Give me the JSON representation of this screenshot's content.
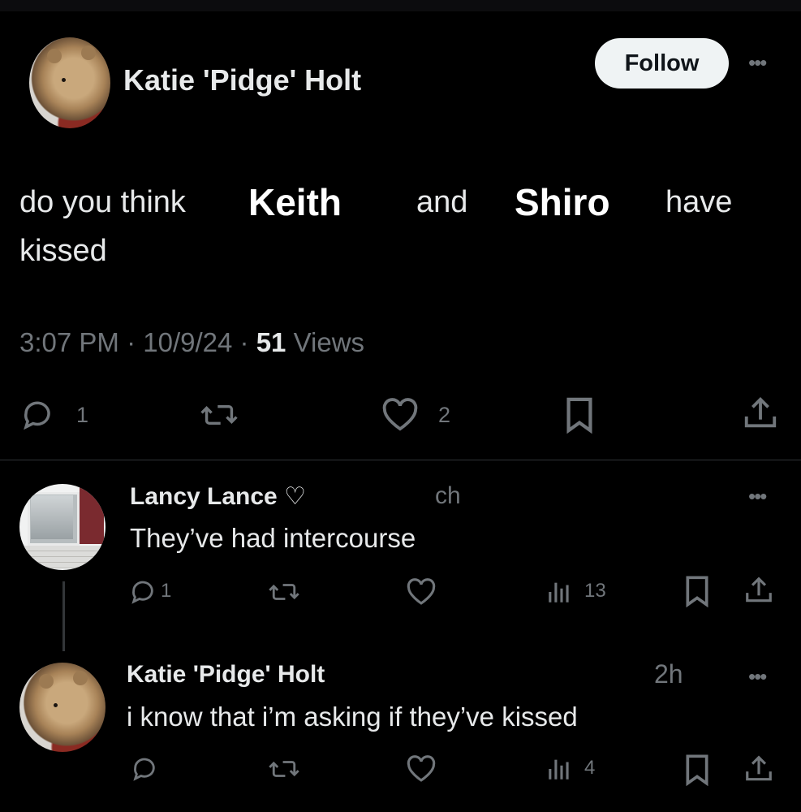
{
  "post": {
    "author": "Katie 'Pidge' Holt",
    "follow_label": "Follow",
    "more_icon": "more-dots-icon",
    "text": {
      "part1": "do you think",
      "name1": "Keith",
      "part2": "and",
      "name2": "Shiro",
      "part3": "have",
      "part4": "kissed"
    },
    "time": "3:07 PM",
    "date": "10/9/24",
    "views_count": "51",
    "views_label": "Views",
    "replies": "1",
    "likes": "2"
  },
  "replies": [
    {
      "author": "Lancy Lance ♡",
      "time": "ch",
      "text": "They’ve had intercourse",
      "replies": "1",
      "views": "13"
    },
    {
      "author": "Katie 'Pidge' Holt",
      "time": "2h",
      "text": "i know that i’m asking if they’ve kissed",
      "views": "4"
    }
  ],
  "icons": {
    "reply": "reply-icon",
    "repost": "repost-icon",
    "like": "like-icon",
    "bookmark": "bookmark-icon",
    "share": "share-icon",
    "views": "views-icon"
  },
  "colors": {
    "background": "#000000",
    "text": "#e7e9ea",
    "muted": "#71767b",
    "follow_bg": "#eff3f4"
  }
}
